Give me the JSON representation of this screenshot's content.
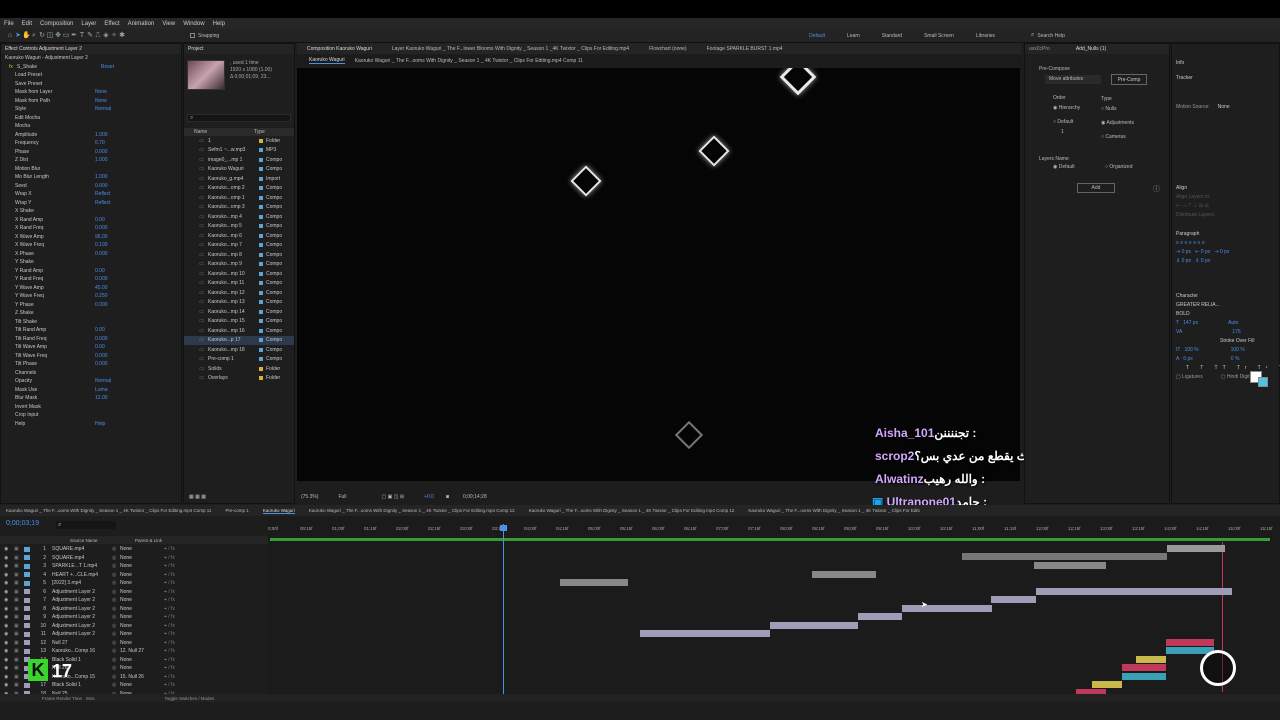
{
  "menu": [
    "File",
    "Edit",
    "Composition",
    "Layer",
    "Effect",
    "Animation",
    "View",
    "Window",
    "Help"
  ],
  "toolbar": {
    "snapping": "Snapping",
    "workspaces": [
      "Default",
      "Learn",
      "Standard",
      "Small Screen",
      "Libraries"
    ],
    "search_help": "Search Help"
  },
  "effect_controls": {
    "tab": "Effect Controls Adjustment Layer 2",
    "layer_path": "Kaoruko Waguri - Adjustment Layer 2",
    "effect_name": "S_Shake",
    "reset": "Reset",
    "load_preset": "Load Preset",
    "save_preset": "Save Preset",
    "rows": [
      {
        "label": "Load Preset",
        "value": ""
      },
      {
        "label": "Save Preset",
        "value": ""
      },
      {
        "label": "Mask from Layer",
        "value": "None"
      },
      {
        "label": "Mask from Path",
        "value": "None"
      },
      {
        "label": "Style",
        "value": "Normal"
      },
      {
        "label": "Edit Mocha",
        "value": ""
      },
      {
        "label": "Mocha",
        "value": ""
      },
      {
        "label": "Amplitude",
        "value": "1.000"
      },
      {
        "label": "Frequency",
        "value": "6.70"
      },
      {
        "label": "Phase",
        "value": "0.000"
      },
      {
        "label": "Z Dist",
        "value": "1.000"
      },
      {
        "label": "Motion Blur",
        "value": ""
      },
      {
        "label": "Mo Blur Length",
        "value": "1.000"
      },
      {
        "label": "Seed",
        "value": "0.000"
      },
      {
        "label": "Wrap X",
        "value": "Reflect"
      },
      {
        "label": "Wrap Y",
        "value": "Reflect"
      },
      {
        "label": "X Shake",
        "value": ""
      },
      {
        "label": "X Rand Amp",
        "value": "0.00"
      },
      {
        "label": "X Rand Freq",
        "value": "0.000"
      },
      {
        "label": "X Wave Amp",
        "value": "95.00"
      },
      {
        "label": "X Wave Freq",
        "value": "0.190"
      },
      {
        "label": "X Phase",
        "value": "0.000"
      },
      {
        "label": "Y Shake",
        "value": ""
      },
      {
        "label": "Y Rand Amp",
        "value": "0.00"
      },
      {
        "label": "Y Rand Freq",
        "value": "0.000"
      },
      {
        "label": "Y Wave Amp",
        "value": "45.00"
      },
      {
        "label": "Y Wave Freq",
        "value": "0.250"
      },
      {
        "label": "Y Phase",
        "value": "0.000"
      },
      {
        "label": "Z Shake",
        "value": ""
      },
      {
        "label": "Tilt Shake",
        "value": ""
      },
      {
        "label": "Tilt Rand Amp",
        "value": "0.00"
      },
      {
        "label": "Tilt Rand Freq",
        "value": "0.000"
      },
      {
        "label": "Tilt Wave Amp",
        "value": "0.00"
      },
      {
        "label": "Tilt Wave Freq",
        "value": "0.000"
      },
      {
        "label": "Tilt Phase",
        "value": "0.000"
      },
      {
        "label": "Channels",
        "value": ""
      },
      {
        "label": "Opacity",
        "value": "Normal"
      },
      {
        "label": "Mask Use",
        "value": "Luma"
      },
      {
        "label": "Blur Mask",
        "value": "12.00"
      },
      {
        "label": "Invert Mask",
        "value": ""
      },
      {
        "label": "Crop Input",
        "value": ""
      },
      {
        "label": "Help",
        "value": "Help"
      }
    ]
  },
  "project": {
    "tab": "Project",
    "info_used": ", used 1 time",
    "info_size": "1920 x 1080 (1.00)",
    "info_dur": "Δ 0;00;01;09, 23...",
    "col_name": "Name",
    "col_type": "Type",
    "items": [
      {
        "name": "1",
        "type": "Folder",
        "color": "#d9b43a"
      },
      {
        "name": "Sefm1 ~...w.mp3",
        "type": "MP3",
        "color": "#5aa4d6"
      },
      {
        "name": "image0_...mp 1",
        "type": "Compo",
        "color": "#5aa4d6"
      },
      {
        "name": "Kaoruko Waguri",
        "type": "Compo",
        "color": "#5aa4d6"
      },
      {
        "name": "Kaoruko_g.mp4",
        "type": "Import",
        "color": "#5aa4d6"
      },
      {
        "name": "Kaoruko...omp 2",
        "type": "Compo",
        "color": "#5aa4d6"
      },
      {
        "name": "Kaoruko...omp 1",
        "type": "Compo",
        "color": "#5aa4d6"
      },
      {
        "name": "Kaoruko...omp 3",
        "type": "Compo",
        "color": "#5aa4d6"
      },
      {
        "name": "Kaoruko...mp 4",
        "type": "Compo",
        "color": "#5aa4d6"
      },
      {
        "name": "Kaoruko...mp 5",
        "type": "Compo",
        "color": "#5aa4d6"
      },
      {
        "name": "Kaoruko...mp 6",
        "type": "Compo",
        "color": "#5aa4d6"
      },
      {
        "name": "Kaoruko...mp 7",
        "type": "Compo",
        "color": "#5aa4d6"
      },
      {
        "name": "Kaoruko...mp 8",
        "type": "Compo",
        "color": "#5aa4d6"
      },
      {
        "name": "Kaoruko...mp 9",
        "type": "Compo",
        "color": "#5aa4d6"
      },
      {
        "name": "Kaoruko...mp 10",
        "type": "Compo",
        "color": "#5aa4d6"
      },
      {
        "name": "Kaoruko...mp 11",
        "type": "Compo",
        "color": "#5aa4d6"
      },
      {
        "name": "Kaoruko...mp 12",
        "type": "Compo",
        "color": "#5aa4d6"
      },
      {
        "name": "Kaoruko...mp 13",
        "type": "Compo",
        "color": "#5aa4d6"
      },
      {
        "name": "Kaoruko...mp 14",
        "type": "Compo",
        "color": "#5aa4d6"
      },
      {
        "name": "Kaoruko...mp 15",
        "type": "Compo",
        "color": "#5aa4d6"
      },
      {
        "name": "Kaoruko...mp 16",
        "type": "Compo",
        "color": "#5aa4d6"
      },
      {
        "name": "Kaoruko...p 17",
        "type": "Compo",
        "color": "#5aa4d6"
      },
      {
        "name": "Kaoruko...mp 18",
        "type": "Compo",
        "color": "#5aa4d6"
      },
      {
        "name": "Pre-comp 1",
        "type": "Compo",
        "color": "#5aa4d6"
      },
      {
        "name": "Solids",
        "type": "Folder",
        "color": "#d9b43a"
      },
      {
        "name": "Overlays",
        "type": "Folder",
        "color": "#d9b43a"
      }
    ]
  },
  "viewer": {
    "tab_comp": "Composition Kaoruko Waguri",
    "tab_layer": "Layer Kaoruko Waguri _ The F...lower Blooms With Dignity _ Season 1 _4K Twixtor _ Clips For Editing.mp4",
    "tab_flowchart": "Flowchart (none)",
    "tab_footage": "Footage SPARKLE BURST 1.mp4",
    "breadcrumb1": "Kaoruko Waguri",
    "breadcrumb2": "Kaoruko Waguri _ The F...ooms With Dignity _ Season 1 _ 4K Twixtor _ Clips For Editing.mp4 Comp 11",
    "zoom": "(75.3%)",
    "quality": "Full",
    "timecode": "0;00;14;28",
    "exposure": "+0.0"
  },
  "chat": [
    {
      "user": "Aisha_101",
      "msg": "تجننننن : "
    },
    {
      "user": "scrop2",
      "msg": "البث يقطع من عدي بس؟ : "
    },
    {
      "user": "Alwatinz",
      "msg": "والله رهيب : "
    },
    {
      "user": "Ultranone01",
      "msg": "جامد : "
    }
  ],
  "extension": {
    "tabs": [
      "uvx2cPro",
      "Add_Nulls (1)"
    ],
    "precompose": "Pre-Compose",
    "move_attributes": "Move attributes",
    "precomp_btn": "Pre-Comp",
    "order": "Order",
    "type": "Type",
    "hierarchy": "Hierarchy",
    "default": "Default",
    "nulls": "Nulls",
    "adjustments": "Adjustments",
    "cameras": "Cameras",
    "count": "1",
    "layers_name": "Layers Name",
    "default2": "Default",
    "organized": "Organized",
    "add": "Add"
  },
  "right_panel": {
    "info": "Info",
    "tracker": "Tracker",
    "motion_source_label": "Motion Source:",
    "motion_source": "None",
    "align": "Align",
    "align_layers_to": "Align Layers to:",
    "distribute_layers": "Distribute Layers:",
    "paragraph": "Paragraph",
    "character": "Character",
    "font": "GREATER RELIA...",
    "style": "BOLD",
    "size": "147 px",
    "leading": "Auto",
    "tracking": "176",
    "stroke": "Stroke Over Fill",
    "scale_v": "100 %",
    "scale_h": "100 %",
    "baseline": "0 px",
    "tsume": "0 %",
    "ligatures": "Ligatures",
    "hindi_digits": "Hindi Digits"
  },
  "timeline": {
    "timecode": "0;00;03;19",
    "tabs": [
      "Kaoruko Waguri _ The F...ooms With Dignity _ Season 1 _ 4K Twixtor _ Clips For Editing.mp4 Comp 11",
      "Pre-comp 1",
      "Kaoruko Waguri",
      "Kaoruko Waguri _ The F...ooms With Dignity _ Season 1 _ 4K Twixtor _ Clips For Editing.mp4 Comp 12",
      "Kaoruko Waguri _ The F...ooms With Dignity _ Season 1 _ 4K Twixtor _ Clips For Editing.mp4 Comp 12",
      "Kaoruko Waguri _ The F...ooms With Dignity _ Season 1 _ 4K Twixtor _ Clips For Editi"
    ],
    "col_source": "Source Name",
    "col_parent": "Parent & Link",
    "ruler": [
      "0;00f",
      "00;15f",
      "01;00f",
      "01;15f",
      "02;00f",
      "02;15f",
      "03;00f",
      "03;15f",
      "04;00f",
      "04;15f",
      "05;00f",
      "05;15f",
      "06;00f",
      "06;15f",
      "07;00f",
      "07;15f",
      "08;00f",
      "08;15f",
      "09;00f",
      "09;15f",
      "10;00f",
      "10;15f",
      "11;00f",
      "11;15f",
      "12;00f",
      "12;15f",
      "13;00f",
      "13;15f",
      "14;00f",
      "14;15f",
      "15;00f",
      "15;15f"
    ],
    "layers": [
      {
        "num": "1",
        "name": "SQUARE.mp4",
        "parent": "None"
      },
      {
        "num": "2",
        "name": "SQUARE.mp4",
        "parent": "None"
      },
      {
        "num": "3",
        "name": "SPARKLE...T 1.mp4",
        "parent": "None"
      },
      {
        "num": "4",
        "name": "HEART +...CLE.mp4",
        "parent": "None"
      },
      {
        "num": "5",
        "name": "[2022] 3.mp4",
        "parent": "None"
      },
      {
        "num": "6",
        "name": "Adjustment Layer 2",
        "parent": "None"
      },
      {
        "num": "7",
        "name": "Adjustment Layer 2",
        "parent": "None"
      },
      {
        "num": "8",
        "name": "Adjustment Layer 2",
        "parent": "None"
      },
      {
        "num": "9",
        "name": "Adjustment Layer 2",
        "parent": "None"
      },
      {
        "num": "10",
        "name": "Adjustment Layer 2",
        "parent": "None"
      },
      {
        "num": "11",
        "name": "Adjustment Layer 2",
        "parent": "None"
      },
      {
        "num": "12",
        "name": "Null 27",
        "parent": "None"
      },
      {
        "num": "13",
        "name": "Kaoruko...Comp 16",
        "parent": "12. Null 27"
      },
      {
        "num": "14",
        "name": "Black Solid 1",
        "parent": "None"
      },
      {
        "num": "15",
        "name": "Null 26",
        "parent": "None"
      },
      {
        "num": "16",
        "name": "Kaoruko...Comp 15",
        "parent": "15. Null 26"
      },
      {
        "num": "17",
        "name": "Black Solid 1",
        "parent": "None"
      },
      {
        "num": "18",
        "name": "Null 25",
        "parent": "None"
      }
    ],
    "footer_left": "Frame Render Time",
    "footer_ms": "0ms",
    "footer_mid": "Toggle Switches / Modes",
    "overlay_number": "17"
  },
  "colors": {
    "accent": "#4d8fea",
    "chat_user": "#d2a8ff",
    "bar": "#9e9cb6",
    "red_bar": "#c0395a",
    "yellow_bar": "#c9b94a",
    "teal_bar": "#3aa0b6"
  }
}
